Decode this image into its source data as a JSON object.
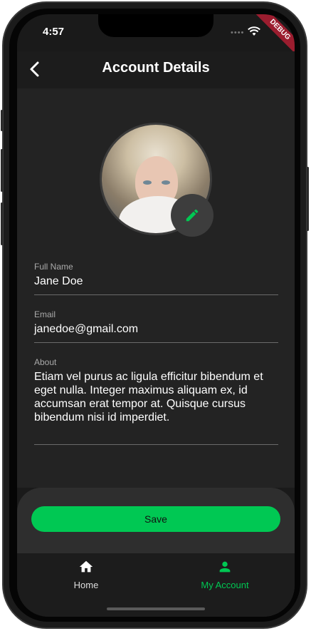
{
  "status_bar": {
    "time": "4:57",
    "signal": "••••",
    "debug_banner": "DEBUG"
  },
  "app_bar": {
    "title": "Account Details"
  },
  "profile": {
    "full_name_label": "Full Name",
    "full_name": "Jane Doe",
    "email_label": "Email",
    "email": "janedoe@gmail.com",
    "about_label": "About",
    "about": "Etiam vel purus ac ligula efficitur bibendum et eget nulla. Integer maximus aliquam ex, id accumsan erat tempor at. Quisque cursus bibendum nisi id imperdiet."
  },
  "actions": {
    "save_label": "Save"
  },
  "bottom_nav": {
    "items": [
      {
        "label": "Home",
        "icon": "home-icon",
        "active": false
      },
      {
        "label": "My Account",
        "icon": "person-icon",
        "active": true
      }
    ]
  },
  "colors": {
    "accent": "#00c853",
    "background": "#232323",
    "appbar": "#1c1c1c"
  }
}
